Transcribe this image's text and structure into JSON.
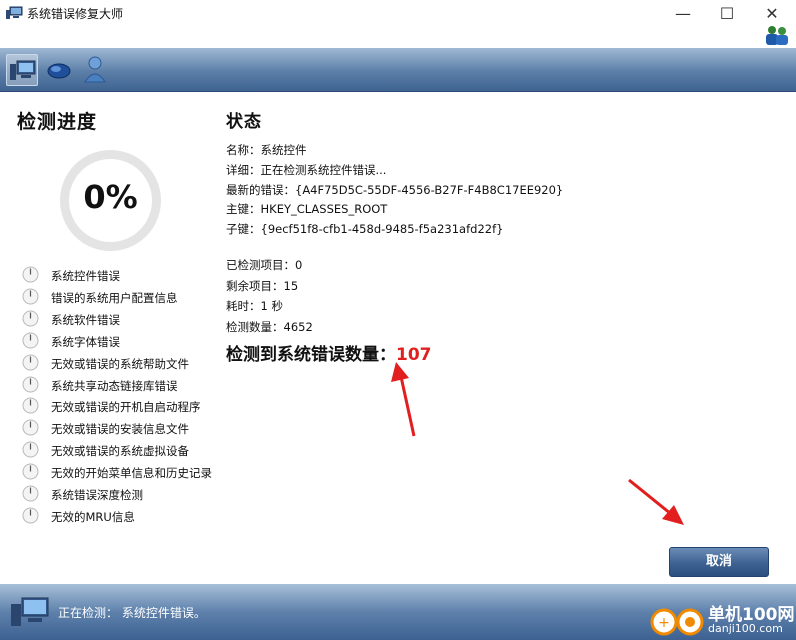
{
  "window": {
    "title": "系统错误修复大师",
    "minimize": "—",
    "maximize": "☐",
    "close": "✕"
  },
  "toolbar": {
    "icons": [
      "computer-icon",
      "mouse-icon",
      "user-icon"
    ]
  },
  "progress": {
    "title": "检测进度",
    "percent_text": "0%",
    "percent": 0,
    "items": [
      "系统控件错误",
      "错误的系统用户配置信息",
      "系统软件错误",
      "系统字体错误",
      "无效或错误的系统帮助文件",
      "系统共享动态链接库错误",
      "无效或错误的开机自启动程序",
      "无效或错误的安装信息文件",
      "无效或错误的系统虚拟设备",
      "无效的开始菜单信息和历史记录",
      "系统错误深度检测",
      "无效的MRU信息"
    ]
  },
  "status": {
    "title": "状态",
    "name": "名称：系统控件",
    "detail": "详细：正在检测系统控件错误...",
    "latest_error": "最新的错误：{A4F75D5C-55DF-4556-B27F-F4B8C17EE920}",
    "main_key": "主键：HKEY_CLASSES_ROOT",
    "sub_key": "子键：{9ecf51f8-cfb1-458d-9485-f5a231afd22f}",
    "checked_items": "已检测项目：0",
    "remaining_items": "剩余项目：15",
    "elapsed": "耗时：1 秒",
    "check_count": "检测数量：4652",
    "errors_label": "检测到系统错误数量：",
    "errors_count": "107"
  },
  "buttons": {
    "cancel": "取消"
  },
  "statusbar": {
    "text": "正在检测： 系统控件错误。"
  },
  "watermark": {
    "line1": "单机100网",
    "line2": "danji100.com"
  },
  "colors": {
    "accent_blue": "#3d6292",
    "error_red": "#e02020",
    "arrow_red": "#e21e1e"
  }
}
